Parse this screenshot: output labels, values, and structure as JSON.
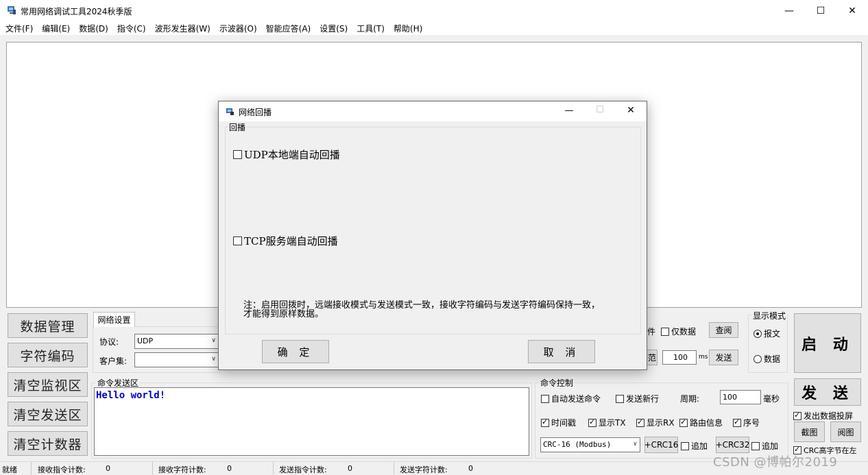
{
  "window": {
    "title": "常用网络调试工具2024秋季版",
    "minimize": "—",
    "maximize": "☐",
    "close": "✕"
  },
  "menu": [
    "文件(F)",
    "编辑(E)",
    "数据(D)",
    "指令(C)",
    "波形发生器(W)",
    "示波器(O)",
    "智能应答(A)",
    "设置(S)",
    "工具(T)",
    "帮助(H)"
  ],
  "left_buttons": [
    "数据管理",
    "字符编码",
    "清空监视区",
    "清空发送区",
    "清空计数器"
  ],
  "net_settings": {
    "tab": "网络设置",
    "protocol_label": "协议:",
    "protocol_value": "UDP",
    "client_label": "客户集:",
    "client_value": ""
  },
  "middle_right": {
    "file_label_partial": "件",
    "only_data_label": "仅数据",
    "view_button": "查阅",
    "partial_button": "范",
    "interval_value": "100",
    "interval_unit": "ms",
    "send_button": "发送"
  },
  "display_mode": {
    "title": "显示模式",
    "options": [
      "报文",
      "数据"
    ],
    "selected": "报文"
  },
  "start_button": "启 动",
  "send_big_button": "发 送",
  "cmd_send": {
    "title": "命令发送区",
    "text": "Hello world!"
  },
  "cmd_control": {
    "title": "命令控制",
    "auto_send": "自动发送命令",
    "send_newline": "发送新行",
    "period_label": "周期:",
    "period_value": "100",
    "period_unit": "毫秒",
    "timestamp": "时间戳",
    "show_tx": "显示TX",
    "show_rx": "显示RX",
    "route_info": "路由信息",
    "seq": "序号",
    "crc_select": "CRC-16 (Modbus)",
    "crc16_button": "+CRC16",
    "append1": "追加",
    "crc32_button": "+CRC32",
    "append2": "追加"
  },
  "right_panel": {
    "send_data_screen": "发出数据投屏",
    "screenshot_button": "截图",
    "view_image_button": "阅图",
    "crc_high_left": "CRC高字节在左"
  },
  "status": {
    "ready": "就绪",
    "rx_cmd_label": "接收指令计数:",
    "rx_cmd_value": "0",
    "rx_char_label": "接收字符计数:",
    "rx_char_value": "0",
    "tx_cmd_label": "发送指令计数:",
    "tx_cmd_value": "0",
    "tx_char_label": "发送字符计数:",
    "tx_char_value": "0"
  },
  "dialog": {
    "title": "网络回播",
    "group_title": "回播",
    "udp_option": "UDP本地端自动回播",
    "tcp_option": "TCP服务端自动回播",
    "note_line1": "注：启用回拨时，远端接收模式与发送模式一致，接收字符编码与发送字符编码保持一致，",
    "note_line2": "才能得到原样数据。",
    "ok_button": "确 定",
    "cancel_button": "取 消"
  },
  "watermark": "CSDN @博帕尔2019"
}
